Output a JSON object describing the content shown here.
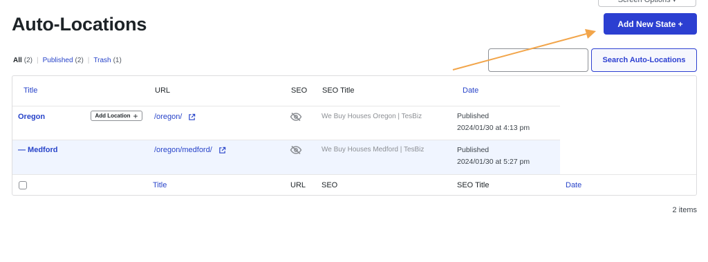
{
  "header": {
    "screen_options_label": "Screen Options ▾",
    "title": "Auto-Locations",
    "add_new_label": "Add New State +"
  },
  "views": [
    {
      "label": "All",
      "count": "(2)",
      "current": true
    },
    {
      "label": "Published",
      "count": "(2)",
      "current": false
    },
    {
      "label": "Trash",
      "count": "(1)",
      "current": false
    }
  ],
  "search": {
    "value": "",
    "button_label": "Search Auto-Locations"
  },
  "table": {
    "header": {
      "title": "Title",
      "url": "URL",
      "seo": "SEO",
      "seo_title": "SEO Title",
      "date": "Date"
    },
    "rows": [
      {
        "title": "Oregon",
        "add_location_label": "Add Location",
        "url": "/oregon/",
        "seo_title": "We Buy Houses Oregon | TesBiz",
        "status": "Published",
        "date": "2024/01/30 at 4:13 pm"
      },
      {
        "title": "— Medford",
        "url": "/oregon/medford/",
        "seo_title": "We Buy Houses Medford | TesBiz",
        "status": "Published",
        "date": "2024/01/30 at 5:27 pm"
      }
    ],
    "footer": {
      "title": "Title",
      "url": "URL",
      "seo": "SEO",
      "seo_title": "SEO Title",
      "date": "Date"
    }
  },
  "items_count": "2 items",
  "colors": {
    "primary": "#2c3fd1",
    "link": "#2743c9",
    "row_alt": "#f0f5ff",
    "annotation_arrow": "#f2a54a"
  },
  "icons": [
    "external-link-icon",
    "seo-hidden-eye-icon",
    "plus-icon",
    "annotation-arrow"
  ]
}
